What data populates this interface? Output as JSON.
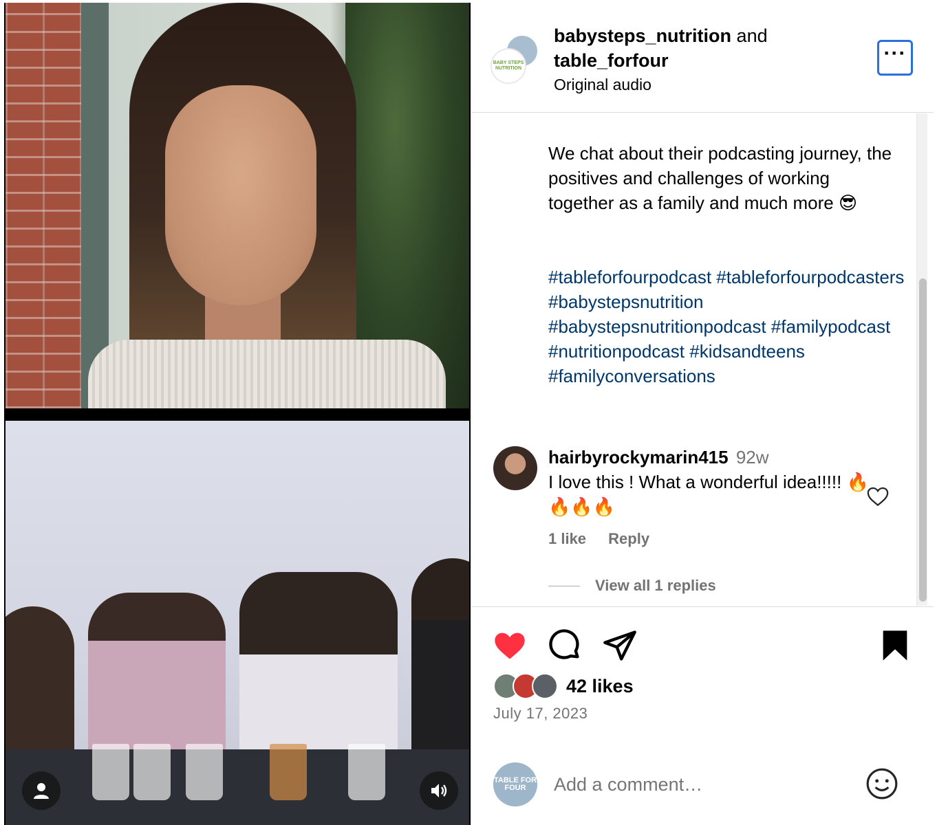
{
  "post": {
    "accounts": "babysteps_nutrition",
    "conjunction": "and",
    "collaborator": "table_forfour",
    "audio": "Original audio",
    "avatar_label": "BABY STEPS NUTRITION"
  },
  "caption": {
    "text": "We chat about their podcasting journey, the positives and challenges of working together as a family and much more 😎",
    "hashtags": "#tableforfourpodcast #tableforfourpodcasters #babystepsnutrition #babystepsnutritionpodcast #familypodcast #nutritionpodcast #kidsandteens #familyconversations"
  },
  "comment": {
    "username": "hairbyrockymarin415",
    "time": "92w",
    "text": "I love this ! What a wonderful idea!!!!! 🔥🔥🔥🔥",
    "likes": "1 like",
    "reply": "Reply",
    "view_replies": "View all 1 replies"
  },
  "footer": {
    "likes": "42 likes",
    "date": "July 17, 2023",
    "comment_placeholder": "Add a comment…",
    "commenter_avatar_label": "TABLE FOR FOUR"
  },
  "colors": {
    "like_red": "#ff3040",
    "hashtag_blue": "#00376b",
    "focus_blue": "#2a6fdb",
    "muted": "#737373"
  },
  "icons": [
    "more-icon",
    "heart-filled-icon",
    "comment-icon",
    "share-icon",
    "bookmark-filled-icon",
    "heart-outline-icon",
    "emoji-icon",
    "user-icon",
    "speaker-icon"
  ]
}
